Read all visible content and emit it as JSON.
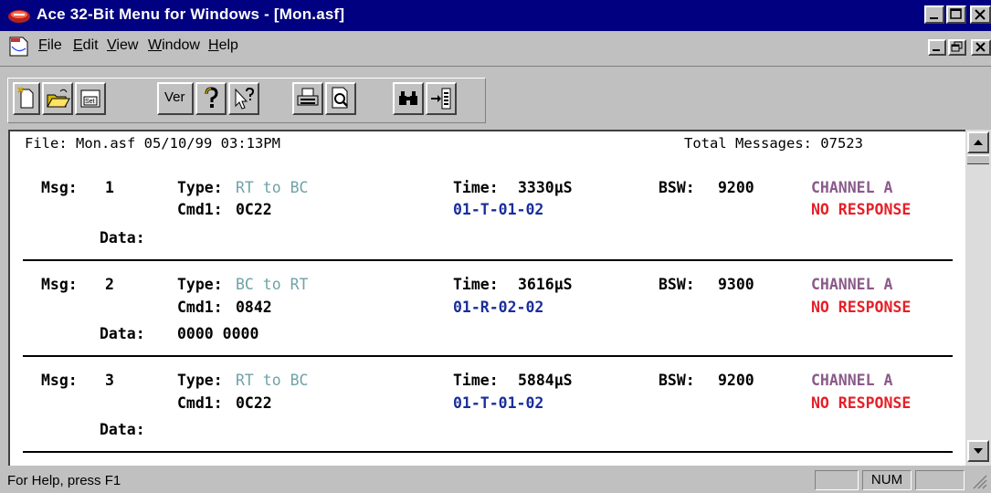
{
  "window": {
    "title": "Ace 32-Bit Menu for Windows - [Mon.asf]"
  },
  "menu": {
    "items": [
      {
        "label": "File",
        "underline": "F",
        "rest": "ile"
      },
      {
        "label": "Edit",
        "underline": "E",
        "rest": "dit"
      },
      {
        "label": "View",
        "underline": "V",
        "rest": "iew"
      },
      {
        "label": "Window",
        "underline": "W",
        "rest": "indow"
      },
      {
        "label": "Help",
        "underline": "H",
        "rest": "elp"
      }
    ]
  },
  "toolbar": {
    "buttons": [
      {
        "icon": "new-file-icon"
      },
      {
        "icon": "open-folder-icon"
      },
      {
        "icon": "save-settings-icon"
      },
      {
        "icon": "version-button",
        "label": "Ver"
      },
      {
        "icon": "help-icon"
      },
      {
        "icon": "context-help-icon"
      },
      {
        "icon": "print-icon"
      },
      {
        "icon": "print-preview-icon"
      },
      {
        "icon": "find-icon"
      },
      {
        "icon": "goto-icon"
      }
    ]
  },
  "header": {
    "file": "File: Mon.asf 05/10/99 03:13PM",
    "total": "Total Messages: 07523"
  },
  "labels": {
    "msg": "Msg:",
    "type": "Type:",
    "cmd1": "Cmd1:",
    "data": "Data:",
    "time": "Time:",
    "bsw": "BSW:"
  },
  "messages": [
    {
      "num": "1",
      "type": "RT to BC",
      "cmd1": "0C22",
      "data": "",
      "time": "3330µS",
      "cmd_decode": "01-T-01-02",
      "bsw": "9200",
      "channel": "CHANNEL A",
      "status": "NO RESPONSE"
    },
    {
      "num": "2",
      "type": "BC to RT",
      "cmd1": "0842",
      "data": "0000 0000",
      "time": "3616µS",
      "cmd_decode": "01-R-02-02",
      "bsw": "9300",
      "channel": "CHANNEL A",
      "status": "NO RESPONSE"
    },
    {
      "num": "3",
      "type": "RT to BC",
      "cmd1": "0C22",
      "data": "",
      "time": "5884µS",
      "cmd_decode": "01-T-01-02",
      "bsw": "9200",
      "channel": "CHANNEL A",
      "status": "NO RESPONSE"
    }
  ],
  "statusbar": {
    "help": "For Help, press F1",
    "num": "NUM"
  },
  "colors": {
    "titlebar": "#000080",
    "type_text": "#6fa2a8",
    "decode_text": "#1a2e9c",
    "channel_text": "#8a5a8a",
    "status_text": "#e51f27"
  }
}
